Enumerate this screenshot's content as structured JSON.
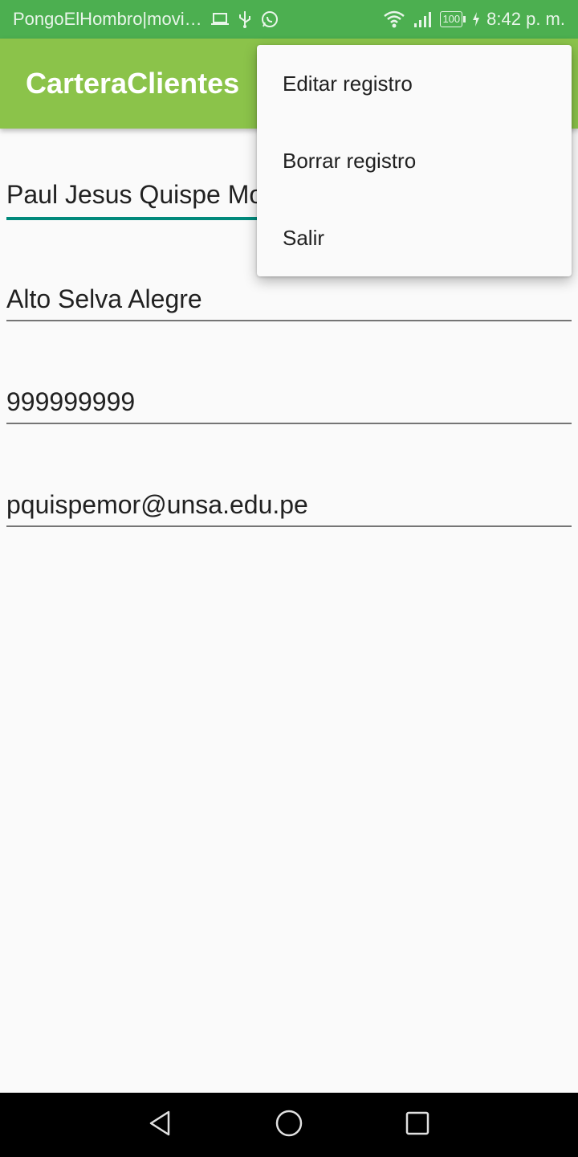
{
  "status_bar": {
    "notification_text": "PongoElHombro|movi…",
    "notification_icons": [
      "laptop-icon",
      "usb-icon",
      "whatsapp-icon"
    ],
    "system_icons": [
      "wifi-icon",
      "signal-icon"
    ],
    "battery": "100",
    "time": "8:42 p. m."
  },
  "app_bar": {
    "title": "CarteraClientes",
    "color": "#8bc34a"
  },
  "form": {
    "name": "Paul Jesus Quispe Morales",
    "district": "Alto Selva Alegre",
    "phone": "999999999",
    "email": "pquispemor@unsa.edu.pe"
  },
  "overflow_menu": {
    "items": [
      {
        "label": "Editar registro"
      },
      {
        "label": "Borrar registro"
      },
      {
        "label": "Salir"
      }
    ]
  },
  "nav_bar": {
    "icons": [
      "back-icon",
      "home-icon",
      "recents-icon"
    ]
  },
  "colors": {
    "status_bar": "#4caf50",
    "accent": "#00897b",
    "background": "#fafafa"
  }
}
